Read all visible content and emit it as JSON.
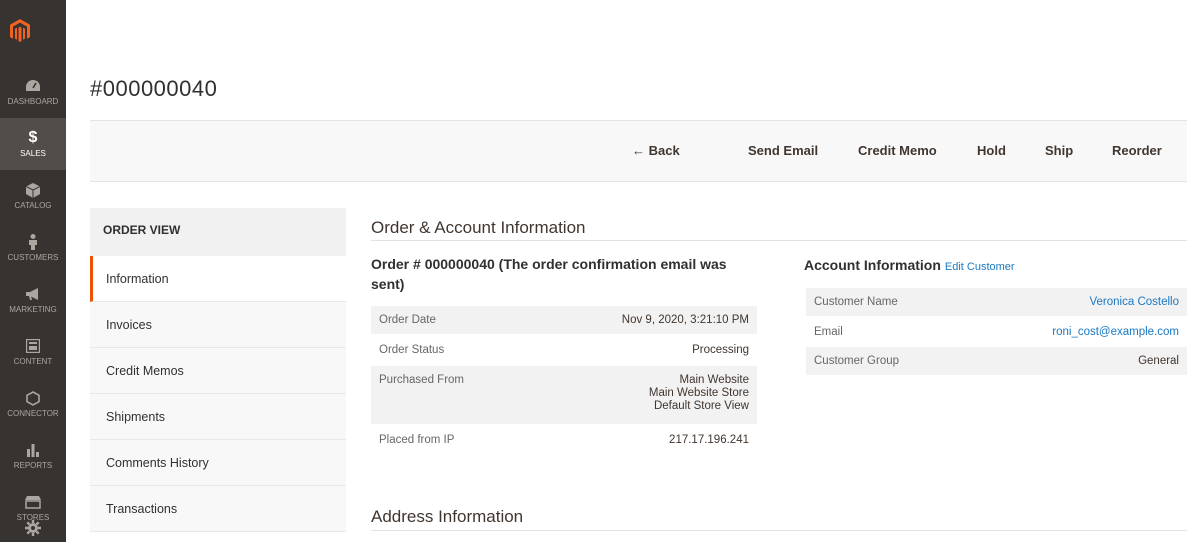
{
  "nav": {
    "items": [
      {
        "label": "DASHBOARD",
        "icon": "gauge-icon"
      },
      {
        "label": "SALES",
        "icon": "dollar-icon"
      },
      {
        "label": "CATALOG",
        "icon": "cube-icon"
      },
      {
        "label": "CUSTOMERS",
        "icon": "person-icon"
      },
      {
        "label": "MARKETING",
        "icon": "megaphone-icon"
      },
      {
        "label": "CONTENT",
        "icon": "layout-icon"
      },
      {
        "label": "CONNECTOR",
        "icon": "hexagon-icon"
      },
      {
        "label": "REPORTS",
        "icon": "bar-chart-icon"
      },
      {
        "label": "STORES",
        "icon": "store-icon"
      },
      {
        "label": "",
        "icon": "gear-icon"
      }
    ]
  },
  "page": {
    "title": "#000000040"
  },
  "toolbar": {
    "back": "← Back",
    "send_email": "Send Email",
    "credit_memo": "Credit Memo",
    "hold": "Hold",
    "ship": "Ship",
    "reorder": "Reorder"
  },
  "order_view": {
    "title": "ORDER VIEW",
    "items": [
      "Information",
      "Invoices",
      "Credit Memos",
      "Shipments",
      "Comments History",
      "Transactions"
    ]
  },
  "main": {
    "section_order_account": "Order & Account Information",
    "order_heading": "Order # 000000040 (The order confirmation email was sent)",
    "order_rows": [
      {
        "label": "Order Date",
        "value": "Nov 9, 2020, 3:21:10 PM"
      },
      {
        "label": "Order Status",
        "value": "Processing"
      },
      {
        "label": "Purchased From",
        "value_lines": [
          "Main Website",
          "Main Website Store",
          "Default Store View"
        ]
      },
      {
        "label": "Placed from IP",
        "value": "217.17.196.241"
      }
    ],
    "account_heading": "Account Information",
    "edit_customer": "Edit Customer",
    "account_rows": [
      {
        "label": "Customer Name",
        "value": "Veronica Costello"
      },
      {
        "label": "Email",
        "value": "roni_cost@example.com"
      },
      {
        "label": "Customer Group",
        "value": "General"
      }
    ],
    "section_address": "Address Information"
  },
  "colors": {
    "nav_bg": "#373330",
    "nav_active": "#524d49",
    "accent": "#eb5202",
    "link": "#1979c3"
  }
}
